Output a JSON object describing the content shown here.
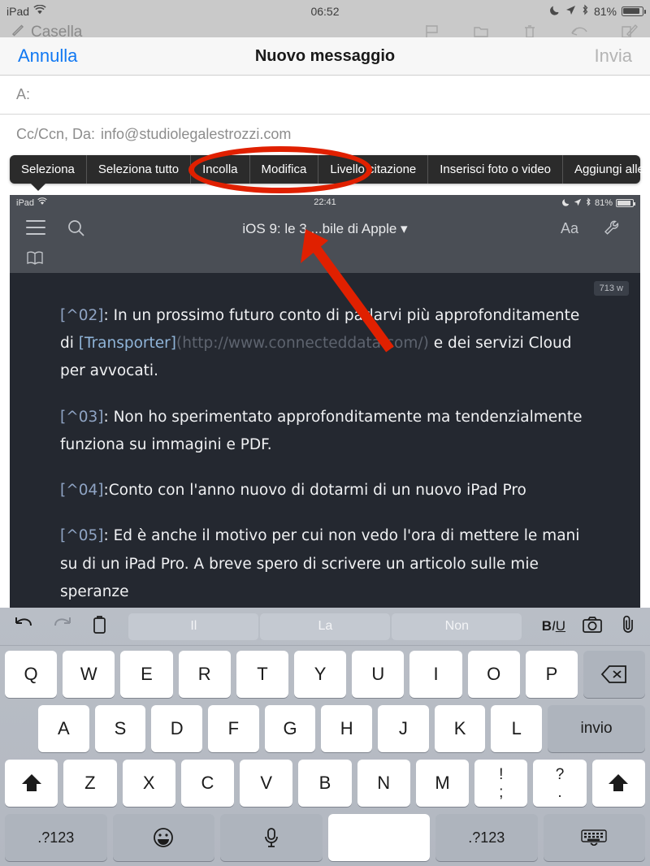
{
  "status_bar": {
    "device": "iPad",
    "wifi_icon": "wifi-icon",
    "time": "06:52",
    "dnd_icon": "moon-icon",
    "location_icon": "location-arrow-icon",
    "bluetooth_icon": "bluetooth-icon",
    "battery_percent": "81%"
  },
  "mail_toolbar": {
    "back_label": "Casella",
    "flag_icon": "flag-icon",
    "folder_icon": "folder-icon",
    "trash_icon": "trash-icon",
    "reply_icon": "reply-icon",
    "compose_icon": "compose-icon"
  },
  "compose": {
    "cancel_label": "Annulla",
    "title": "Nuovo messaggio",
    "send_label": "Invia",
    "to_label": "A:",
    "to_value": "",
    "cc_label": "Cc/Ccn, Da:",
    "from_value": "info@studiolegalestrozzi.com"
  },
  "context_menu": {
    "items": [
      {
        "label": "Seleziona"
      },
      {
        "label": "Seleziona tutto"
      },
      {
        "label": "Incolla"
      },
      {
        "label": "Modifica"
      },
      {
        "label": "Livello citazione"
      },
      {
        "label": "Inserisci foto o video"
      },
      {
        "label": "Aggiungi allegato"
      }
    ]
  },
  "annotations": {
    "ellipse_color": "#e02000",
    "arrow_color": "#e02000",
    "ellipse_target": "Incolla / Modifica",
    "arrow_target": "editor-title"
  },
  "inner_screenshot": {
    "status_bar": {
      "device": "iPad",
      "wifi_icon": "wifi-icon",
      "time": "22:41",
      "dnd_icon": "moon-icon",
      "location_icon": "location-arrow-icon",
      "bluetooth_icon": "bluetooth-icon",
      "battery_percent": "81%"
    },
    "toolbar": {
      "menu_icon": "hamburger-icon",
      "search_icon": "search-icon",
      "title": "iOS 9: le 3 ...bile di Apple ▾",
      "font_label": "Aa",
      "tools_icon": "wrench-icon",
      "book_icon": "book-icon"
    },
    "word_count": "713 w",
    "paragraphs": [
      {
        "ref": "[^02]",
        "segments": [
          {
            "type": "text",
            "value": ": In un prossimo futuro conto di parlarvi più approfonditamente di "
          },
          {
            "type": "link",
            "value": "[Transporter]"
          },
          {
            "type": "url",
            "value": "(http://www.connecteddata.com/)"
          },
          {
            "type": "text",
            "value": "  e dei servizi Cloud per avvocati."
          }
        ]
      },
      {
        "ref": "[^03]",
        "segments": [
          {
            "type": "text",
            "value": ": Non ho  sperimentato approfonditamente ma tendenzialmente funziona su immagini e PDF."
          }
        ]
      },
      {
        "ref": "[^04]",
        "segments": [
          {
            "type": "text",
            "value": ":Conto con l'anno nuovo di dotarmi di un nuovo iPad Pro"
          }
        ]
      },
      {
        "ref": "[^05]",
        "segments": [
          {
            "type": "text",
            "value": ": Ed è anche il motivo per cui non vedo l'ora di mettere le mani su di un iPad Pro. A breve spero di scrivere un articolo sulle mie speranze"
          }
        ]
      }
    ]
  },
  "keyboard": {
    "predictive": {
      "undo_icon": "undo-icon",
      "redo_icon": "redo-icon",
      "paste_icon": "paste-icon",
      "suggestions": [
        "Il",
        "La",
        "Non"
      ],
      "format_label": "BIU",
      "camera_icon": "camera-icon",
      "attach_icon": "paperclip-icon"
    },
    "row1": [
      "Q",
      "W",
      "E",
      "R",
      "T",
      "Y",
      "U",
      "I",
      "O",
      "P"
    ],
    "delete_icon": "backspace-icon",
    "row2": [
      "A",
      "S",
      "D",
      "F",
      "G",
      "H",
      "J",
      "K",
      "L"
    ],
    "enter_label": "invio",
    "shift_icon": "shift-icon",
    "row3": [
      "Z",
      "X",
      "C",
      "V",
      "B",
      "N",
      "M"
    ],
    "punct1": {
      "top": "!",
      "bottom": ";"
    },
    "punct2": {
      "top": "?",
      "bottom": "."
    },
    "numeric_label": ".?123",
    "emoji_icon": "emoji-icon",
    "dictation_icon": "microphone-icon",
    "space_label": "",
    "numeric_label_right": ".?123",
    "hide_keyboard_icon": "hide-keyboard-icon"
  }
}
